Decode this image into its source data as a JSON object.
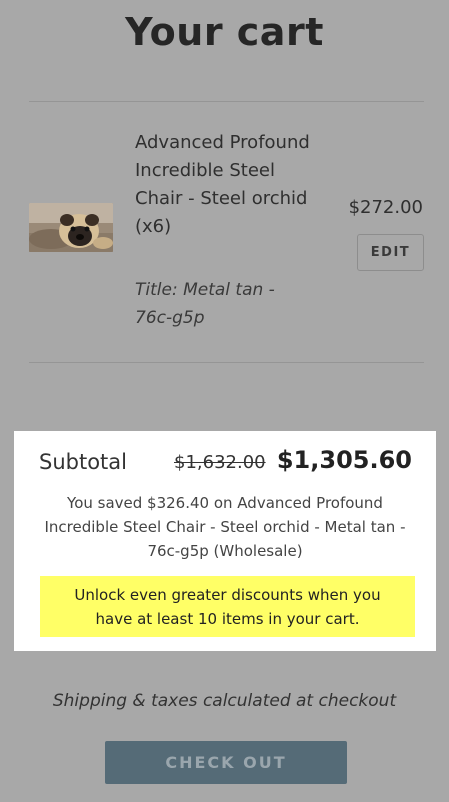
{
  "page": {
    "title": "Your cart"
  },
  "cart_item": {
    "image_icon": "pug-dog-photo",
    "name": "Advanced Profound Incredible Steel Chair - Steel orchid (x6)",
    "variant": "Title: Metal tan - 76c-g5p",
    "price": "$272.00",
    "edit_label": "EDIT"
  },
  "summary": {
    "subtotal_label": "Subtotal",
    "original_total": "$1,632.00",
    "discounted_total": "$1,305.60",
    "savings_text": "You saved $326.40 on Advanced Profound Incredible Steel Chair - Steel orchid - Metal tan - 76c-g5p (Wholesale)",
    "unlock_banner": "Unlock even greater discounts when you have at least 10 items in your cart.",
    "banner_color": "#ffff66"
  },
  "footer": {
    "shipping_note": "Shipping & taxes calculated at checkout",
    "checkout_label": "CHECK OUT",
    "checkout_color": "#556b77"
  }
}
